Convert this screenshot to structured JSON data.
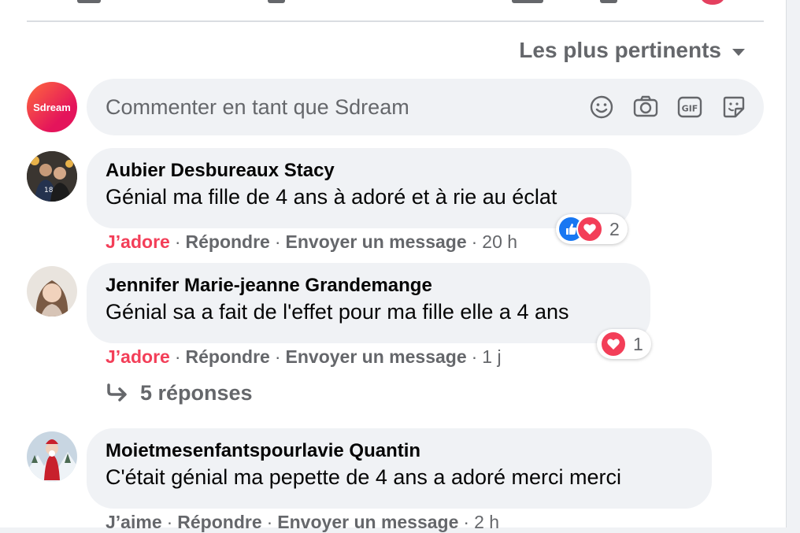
{
  "sort": {
    "label": "Les plus pertinents"
  },
  "composer": {
    "avatar_label": "Sdream",
    "placeholder": "Commenter en tant que Sdream",
    "tools": [
      "emoji-icon",
      "camera-icon",
      "gif-icon",
      "sticker-icon"
    ]
  },
  "comments": [
    {
      "author": "Aubier Desbureaux Stacy",
      "text": "Génial ma fille de 4 ans à adoré et à rie au éclat",
      "reaction_label": "J’adore",
      "reply_label": "Répondre",
      "message_label": "Envoyer un message",
      "time": "20 h",
      "reactions": {
        "types": [
          "like",
          "love"
        ],
        "count": "2"
      }
    },
    {
      "author": "Jennifer Marie-jeanne Grandemange",
      "text": "Génial sa a fait de l'effet pour ma fille elle a 4 ans",
      "reaction_label": "J’adore",
      "reply_label": "Répondre",
      "message_label": "Envoyer un message",
      "time": "1 j",
      "reactions": {
        "types": [
          "love"
        ],
        "count": "1"
      },
      "replies_label": "5 réponses"
    },
    {
      "author": "Moietmesenfantspourlavie Quantin",
      "text": "C'était génial ma pepette de 4 ans a adoré merci merci",
      "reaction_label": "J’aime",
      "reply_label": "Répondre",
      "message_label": "Envoyer un message",
      "time": "2 h"
    }
  ],
  "separator": "·",
  "colors": {
    "love": "#f33e58",
    "like": "#1877f2",
    "muted": "#65676b",
    "bubble": "#f0f2f5"
  }
}
